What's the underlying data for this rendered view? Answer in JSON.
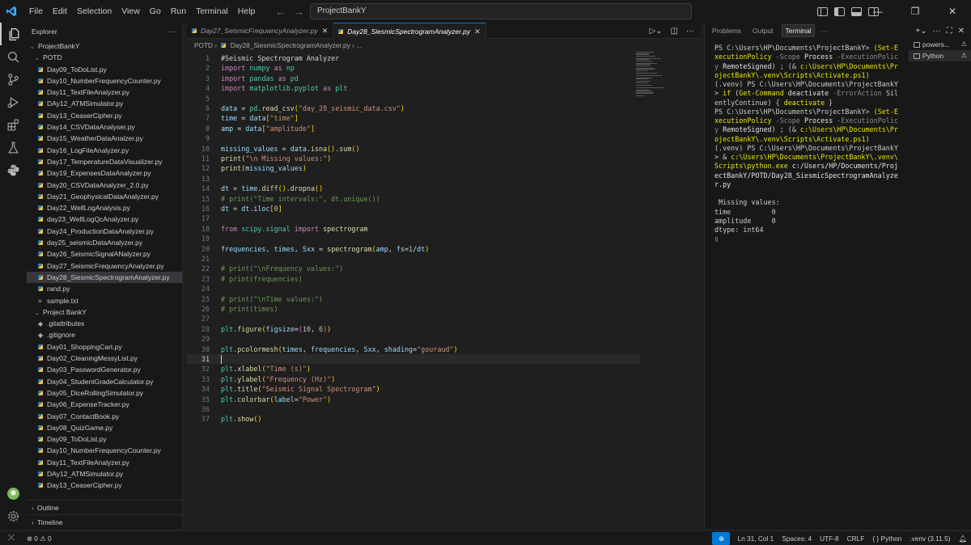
{
  "titlebar": {
    "menu": [
      "File",
      "Edit",
      "Selection",
      "View",
      "Go",
      "Run",
      "Terminal",
      "Help"
    ],
    "search_text": "ProjectBankY"
  },
  "sidebar": {
    "header": "Explorer",
    "root": "ProjectBankY",
    "potd_folder": "POTD",
    "potd_files": [
      "Day09_ToDoList.py",
      "Day10_NumberFrequencyCounter.py",
      "Day11_TextFileAnalyzer.py",
      "DAy12_ATMSimulator.py",
      "Day13_CeaserCipher.py",
      "Day14_CSVDataAnalyser.py",
      "Day15_WeatherDataAnalzer.py",
      "Day16_LogFileAnalyzer.py",
      "Day17_TemperatureDataVisualizer.py",
      "Day19_ExpensesDataAnalyzer.py",
      "Day20_CSVDataAnalyzer_2.0.py",
      "Day21_GeophysicalDataAnalyzer.py",
      "Day22_WellLogAnalysis.py",
      "day23_WellLogQcAnalyzer.py",
      "Day24_ProductionDataAnalyzer.py",
      "day25_seismicDataAnalyzer.py",
      "Day26_SeismicSignalANalyzer.py",
      "Day27_SeismicFrequwncyAnalyzer.py",
      "Day28_SiesmicSpectrogramAnalyzer.py",
      "rand.py",
      "sample.txt"
    ],
    "selected_index": 18,
    "bank_folder": "Project BankY",
    "bank_files": [
      ".gitattributes",
      ".gitignore",
      "Day01_ShoppingCart.py",
      "Day02_CleaningMessyList.py",
      "Day03_PasswordGenerator.py",
      "Day04_StudentGradeCalculator.py",
      "Day05_DiceRollingSimulator.py",
      "Day06_ExpenseTracker.py",
      "Day07_ContactBook.py",
      "Day08_QuizGame.py",
      "Day09_ToDoList.py",
      "Day10_NumberFrequencyCounter.py",
      "Day11_TextFileAnalyzer.py",
      "DAy12_ATMSimulator.py",
      "Day13_CeaserCipher.py"
    ],
    "outline": "Outline",
    "timeline": "Timeline"
  },
  "editor": {
    "tabs": [
      {
        "label": "Day27_SeismicFrequwncyAnalyzer.py",
        "active": false
      },
      {
        "label": "Day28_SiesmicSpectrogramAnalyzer.py",
        "active": true
      }
    ],
    "breadcrumb": {
      "folder": "POTD",
      "file": "Day28_SiesmicSpectrogramAnalyzer.py",
      "more": "..."
    },
    "current_line": 31,
    "line_count": 37
  },
  "panel": {
    "tabs": [
      "Problems",
      "Output",
      "Terminal"
    ],
    "active_tab": "Terminal",
    "terminals": [
      "powers...",
      "Python"
    ],
    "output_lines": [
      "Missing values:",
      "time          0",
      "amplitude     0",
      "dtype: int64"
    ]
  },
  "status": {
    "problems_errors": "0",
    "problems_warnings": "0",
    "position": "Ln 31, Col 1",
    "spaces": "Spaces: 4",
    "encoding": "UTF-8",
    "eol": "CRLF",
    "language": "Python",
    "interpreter": ".venv (3.11.5)"
  },
  "colors": {
    "accent": "#0078d4",
    "background": "#1f1f1f",
    "sidebar": "#181818"
  }
}
